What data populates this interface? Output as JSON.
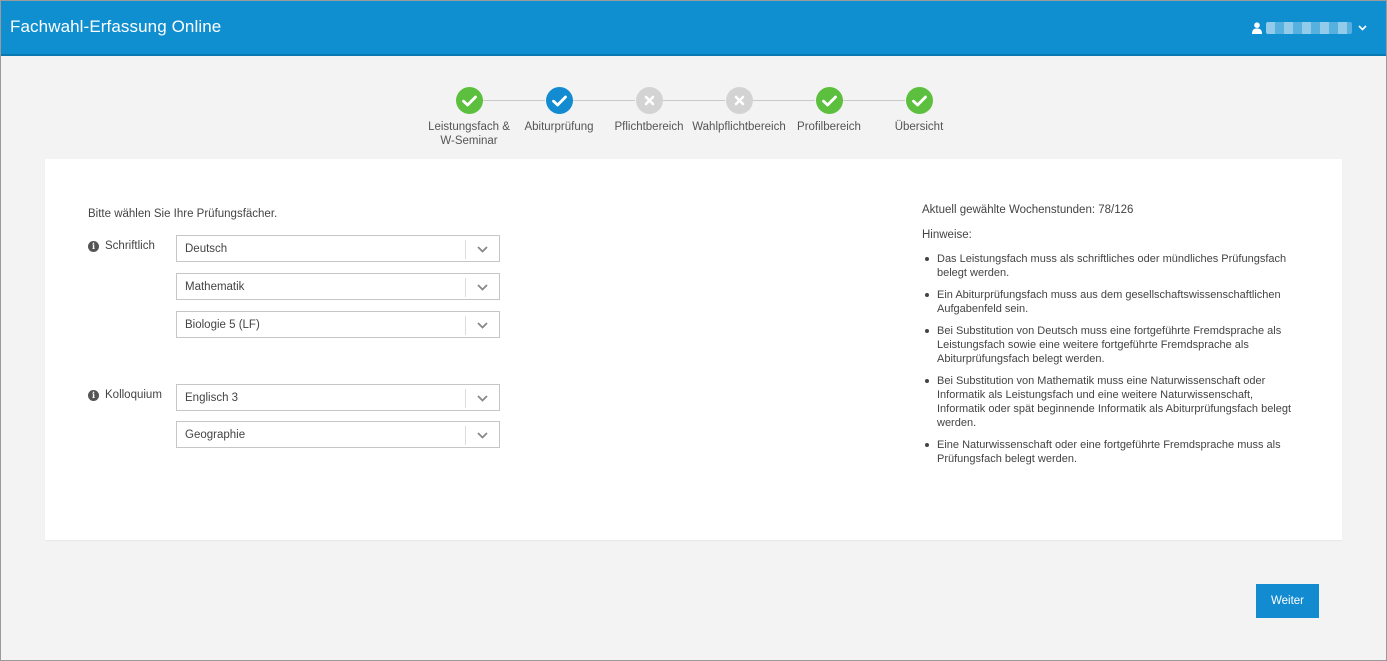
{
  "app": {
    "title": "Fachwahl-Erfassung Online",
    "user_icon": "user-icon",
    "user_caret_icon": "chevron-down-icon"
  },
  "colors": {
    "navbar": "#0f8fd0",
    "step_done": "#5cbf3d",
    "step_active": "#128bd0",
    "step_incomplete": "#d3d3d3",
    "primary_button": "#128bd0"
  },
  "steps": [
    {
      "label_line1": "Leistungsfach &",
      "label_line2": "W-Seminar",
      "state": "done",
      "icon": "check-icon"
    },
    {
      "label_line1": "Abiturprüfung",
      "label_line2": "",
      "state": "active",
      "icon": "check-icon"
    },
    {
      "label_line1": "Pflichtbereich",
      "label_line2": "",
      "state": "incomplete",
      "icon": "x-icon"
    },
    {
      "label_line1": "Wahlpflichtbereich",
      "label_line2": "",
      "state": "incomplete",
      "icon": "x-icon"
    },
    {
      "label_line1": "Profilbereich",
      "label_line2": "",
      "state": "done",
      "icon": "check-icon"
    },
    {
      "label_line1": "Übersicht",
      "label_line2": "",
      "state": "done",
      "icon": "check-icon"
    }
  ],
  "form": {
    "intro": "Bitte wählen Sie Ihre Prüfungsfächer.",
    "written_label": "Schriftlich",
    "written_selects": [
      "Deutsch",
      "Mathematik",
      "Biologie 5 (LF)"
    ],
    "oral_label": "Kolloquium",
    "oral_selects": [
      "Englisch 3",
      "Geographie"
    ]
  },
  "side": {
    "hours": "Aktuell gewählte Wochenstunden: 78/126",
    "hints_title": "Hinweise:",
    "hints": [
      "Das Leistungsfach muss als schriftliches oder mündliches Prüfungsfach belegt werden.",
      "Ein Abiturprüfungsfach muss aus dem gesellschaftswissenschaftlichen Aufgabenfeld sein.",
      "Bei Substitution von Deutsch muss eine fortgeführte Fremdsprache als Leistungsfach sowie eine weitere fortgeführte Fremdsprache als Abiturprüfungsfach belegt werden.",
      "Bei Substitution von Mathematik muss eine Naturwissenschaft oder Informatik als Leistungsfach und eine weitere Naturwissenschaft, Informatik oder spät beginnende Informatik als Abiturprüfungsfach belegt werden.",
      "Eine Naturwissenschaft oder eine fortgeführte Fremdsprache muss als Prüfungsfach belegt werden."
    ]
  },
  "actions": {
    "next_label": "Weiter"
  }
}
